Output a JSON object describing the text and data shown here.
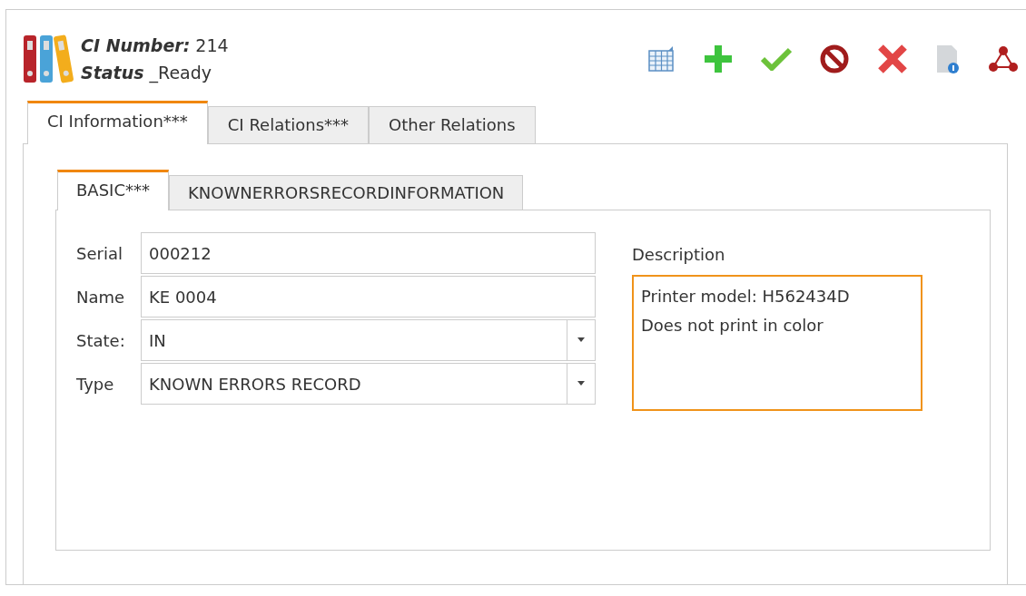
{
  "header": {
    "number_label": "CI Number:",
    "number": "214",
    "status_label": "Status",
    "status": "_Ready"
  },
  "toolbar": [
    {
      "kind": "grid"
    },
    {
      "kind": "add"
    },
    {
      "kind": "check"
    },
    {
      "kind": "block"
    },
    {
      "kind": "delete"
    },
    {
      "kind": "info"
    },
    {
      "kind": "relations"
    }
  ],
  "tabs": [
    {
      "label": "CI Information***",
      "selected": true
    },
    {
      "label": "CI Relations***",
      "selected": false
    },
    {
      "label": "Other Relations",
      "selected": false
    }
  ],
  "subtabs": [
    {
      "label": "BASIC***",
      "selected": true
    },
    {
      "label": "KNOWNERRORSRECORDINFORMATION",
      "selected": false
    }
  ],
  "fields": [
    {
      "label": "Serial",
      "value": "000212",
      "kind": "text"
    },
    {
      "label": "Name",
      "value": "KE 0004",
      "kind": "text"
    },
    {
      "label": "State:",
      "value": "IN",
      "kind": "select"
    },
    {
      "label": "Type",
      "value": "KNOWN ERRORS RECORD",
      "kind": "select"
    }
  ],
  "description": {
    "label": "Description",
    "lines": [
      "Printer model: H562434D",
      "Does not print in color"
    ]
  }
}
